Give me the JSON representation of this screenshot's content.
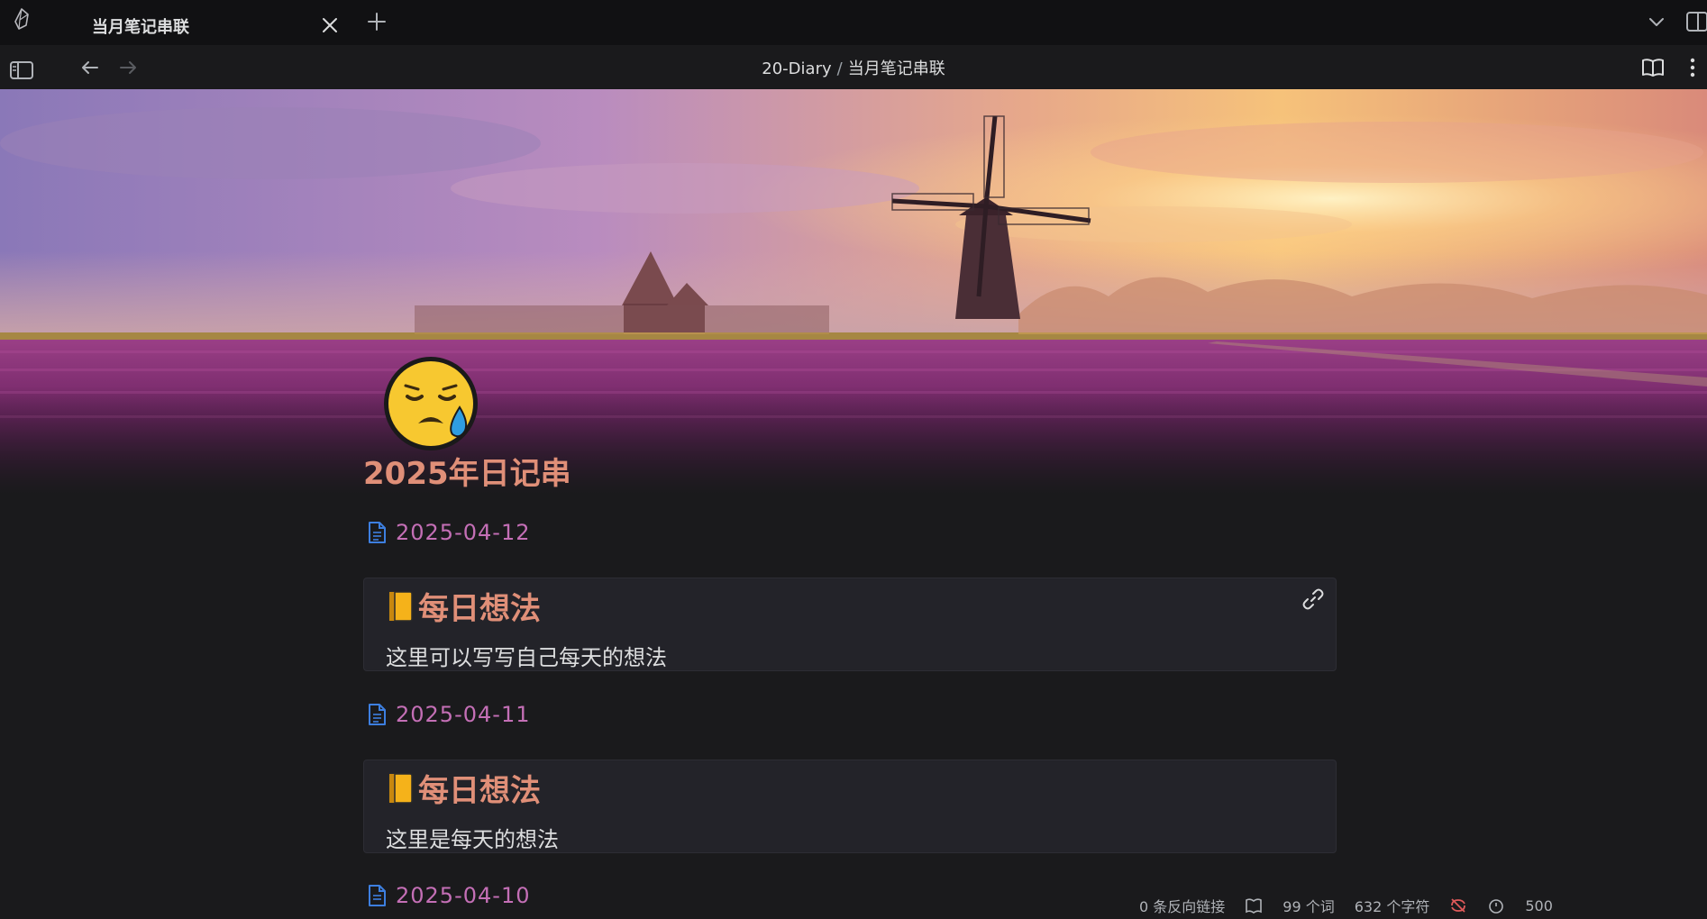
{
  "tabbar": {
    "active_tab_title": "当月笔记串联"
  },
  "navbar": {
    "breadcrumb_folder": "20-Diary",
    "breadcrumb_separator": "/",
    "breadcrumb_note": "当月笔记串联"
  },
  "page": {
    "icon_emoji": "😓",
    "title": "2025年日记串"
  },
  "entries": [
    {
      "date": "2025-04-12",
      "heading": "每日想法",
      "body": "这里可以写写自己每天的想法"
    },
    {
      "date": "2025-04-11",
      "heading": "每日想法",
      "body": "这里是每天的想法"
    },
    {
      "date": "2025-04-10"
    }
  ],
  "statusbar": {
    "backlinks": "0 条反向链接",
    "word_count": "99 个词",
    "char_count": "632 个字符",
    "num": "500"
  },
  "colors": {
    "accent_heading": "#e08f78",
    "link_date": "#c46fb6",
    "background": "#1a1a1c"
  }
}
